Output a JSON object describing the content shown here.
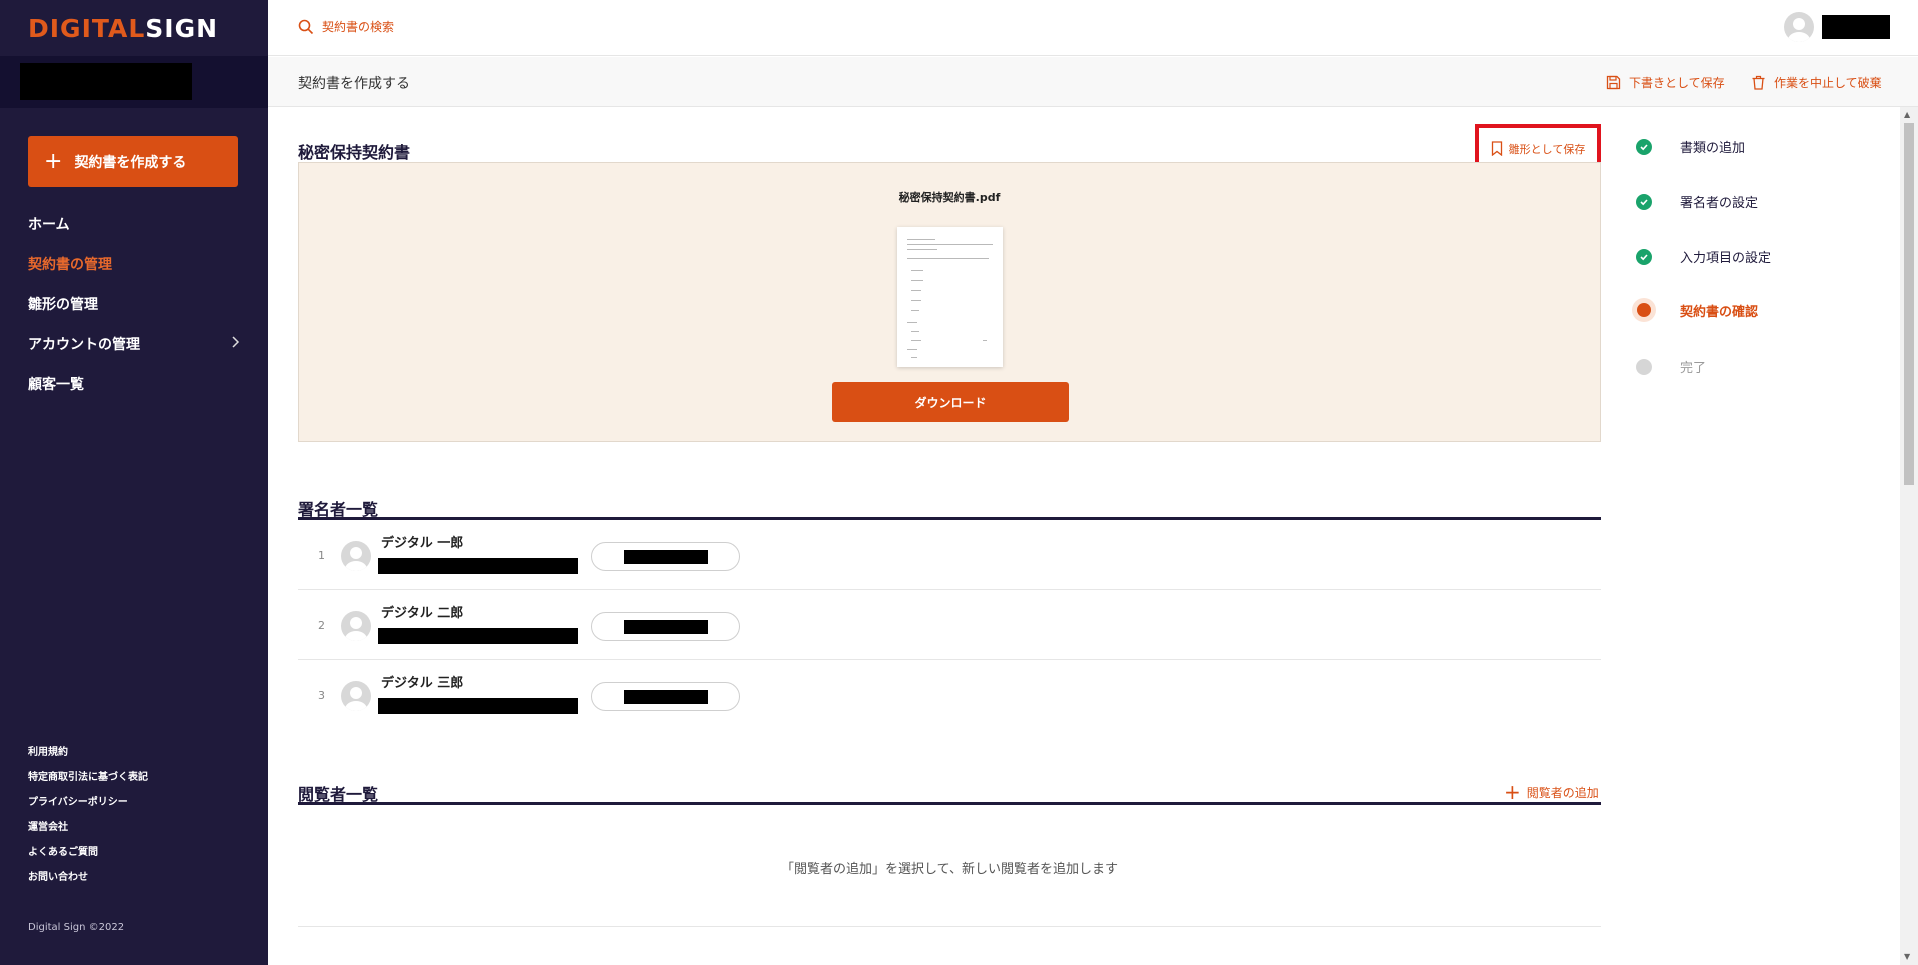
{
  "brand": {
    "logo_accent": "DIGITAL",
    "logo_rest": "SIGN",
    "accent_color": "#d94f14",
    "sidebar_color": "#1f1a3b"
  },
  "sidebar": {
    "create_label": "契約書を作成する",
    "nav": [
      {
        "label": "ホーム"
      },
      {
        "label": "契約書の管理",
        "active": true
      },
      {
        "label": "雛形の管理"
      },
      {
        "label": "アカウントの管理",
        "has_submenu": true
      },
      {
        "label": "顧客一覧"
      }
    ],
    "footer_links": [
      "利用規約",
      "特定商取引法に基づく表記",
      "プライバシーポリシー",
      "運営会社",
      "よくあるご質問",
      "お問い合わせ"
    ],
    "copyright": "Digital Sign ©2022"
  },
  "topbar": {
    "search_label": "契約書の検索"
  },
  "header": {
    "title": "契約書を作成する",
    "save_draft": "下書きとして保存",
    "discard": "作業を中止して破棄"
  },
  "document": {
    "section_title": "秘密保持契約書",
    "save_template": "雛形として保存",
    "file_name": "秘密保持契約書.pdf",
    "download_label": "ダウンロード"
  },
  "signers": {
    "section_title": "署名者一覧",
    "items": [
      {
        "num": "1",
        "name": "デジタル 一郎"
      },
      {
        "num": "2",
        "name": "デジタル 二郎"
      },
      {
        "num": "3",
        "name": "デジタル 三郎"
      }
    ]
  },
  "viewers": {
    "section_title": "閲覧者一覧",
    "add_label": "閲覧者の追加",
    "empty_message": "「閲覧者の追加」を選択して、新しい閲覧者を追加します"
  },
  "steps": [
    {
      "label": "書類の追加",
      "state": "done"
    },
    {
      "label": "署名者の設定",
      "state": "done"
    },
    {
      "label": "入力項目の設定",
      "state": "done"
    },
    {
      "label": "契約書の確認",
      "state": "current"
    },
    {
      "label": "完了",
      "state": "pending"
    }
  ]
}
